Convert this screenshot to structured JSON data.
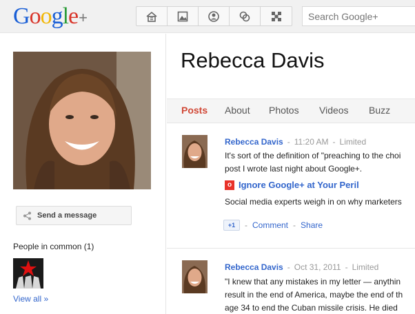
{
  "header": {
    "logo_text": "Google",
    "logo_suffix": "+",
    "search_placeholder": "Search Google+",
    "nav": [
      {
        "icon": "home-icon"
      },
      {
        "icon": "photos-icon"
      },
      {
        "icon": "profile-icon"
      },
      {
        "icon": "circles-icon"
      },
      {
        "icon": "games-icon"
      }
    ]
  },
  "profile": {
    "name": "Rebecca Davis",
    "send_message_label": "Send a message",
    "people_in_common_label": "People in common (1)",
    "view_all_label": "View all »"
  },
  "tabs": [
    {
      "label": "Posts",
      "active": true
    },
    {
      "label": "About",
      "active": false
    },
    {
      "label": "Photos",
      "active": false
    },
    {
      "label": "Videos",
      "active": false
    },
    {
      "label": "Buzz",
      "active": false
    }
  ],
  "posts": [
    {
      "author": "Rebecca Davis",
      "time": "11:20 AM",
      "visibility": "Limited",
      "lines": [
        "It's sort of the definition of \"preaching to the choi",
        "post I wrote last night about Google+."
      ],
      "link_title": "Ignore Google+ at Your Peril",
      "link_desc": "Social media experts weigh in on why marketers",
      "plusone_label": "+1",
      "comment_label": "Comment",
      "share_label": "Share"
    },
    {
      "author": "Rebecca Davis",
      "time": "Oct 31, 2011",
      "visibility": "Limited",
      "lines": [
        "\"I knew that any mistakes in my letter — anythin",
        "result in the end of America, maybe the end of th",
        "age 34 to end the Cuban missile crisis. He died"
      ]
    }
  ],
  "colors": {
    "link": "#3366cc",
    "active_tab": "#d14836",
    "meta": "#999999"
  }
}
